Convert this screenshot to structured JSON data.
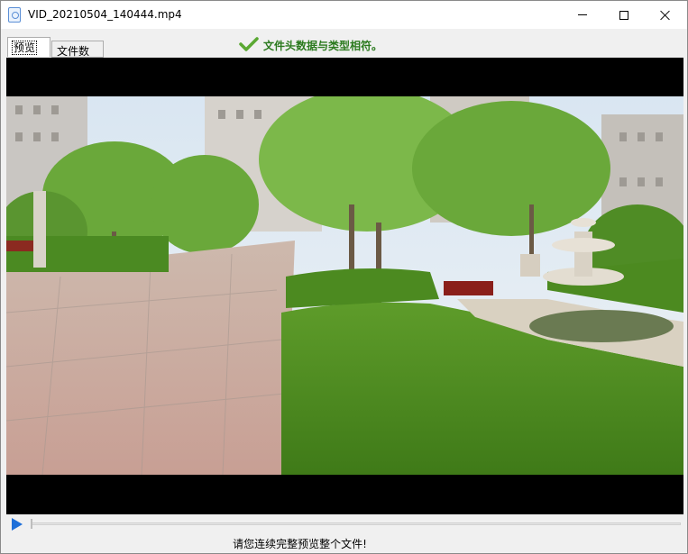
{
  "window": {
    "title": "VID_20210504_140444.mp4",
    "icon": "video-file-icon"
  },
  "tabs": [
    {
      "label": "预览",
      "active": true
    },
    {
      "label": "文件数据",
      "active": false
    }
  ],
  "status": {
    "icon": "checkmark-icon",
    "text": "文件头数据与类型相符。",
    "color": "#2b7a1e"
  },
  "player": {
    "play_icon": "play-icon",
    "accent": "#1e6fd9",
    "progress": 0
  },
  "hint": "请您连续完整预览整个文件!"
}
